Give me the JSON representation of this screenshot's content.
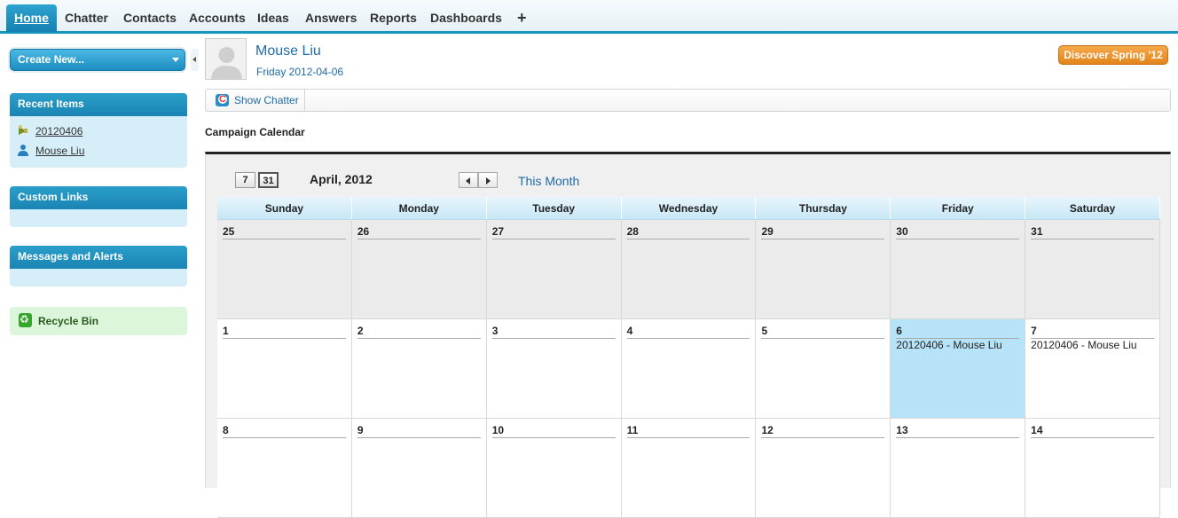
{
  "tabs": [
    {
      "label": "Home",
      "active": true
    },
    {
      "label": "Chatter"
    },
    {
      "label": "Contacts"
    },
    {
      "label": "Accounts"
    },
    {
      "label": "Ideas"
    },
    {
      "label": "Answers"
    },
    {
      "label": "Reports"
    },
    {
      "label": "Dashboards"
    },
    {
      "label": "+",
      "icon": "plus-icon"
    }
  ],
  "sidebar": {
    "create_new": "Create New...",
    "recent_items": {
      "title": "Recent Items",
      "items": [
        {
          "label": "20120406",
          "icon": "campaign-icon"
        },
        {
          "label": "Mouse Liu",
          "icon": "user-icon"
        }
      ]
    },
    "custom_links": {
      "title": "Custom Links"
    },
    "messages": {
      "title": "Messages and Alerts"
    },
    "recycle_bin": {
      "label": "Recycle Bin",
      "icon": "recycle-bin-icon"
    }
  },
  "header": {
    "user_name": "Mouse Liu",
    "date": "Friday 2012-04-06",
    "discover": "Discover Spring '12"
  },
  "chatter": {
    "show_label": "Show Chatter",
    "icon": "chatter-icon"
  },
  "calendar": {
    "section_title": "Campaign Calendar",
    "view_day": "7",
    "view_month": "31",
    "month_title": "April, 2012",
    "this_month": "This Month",
    "weekdays": [
      "Sunday",
      "Monday",
      "Tuesday",
      "Wednesday",
      "Thursday",
      "Friday",
      "Saturday"
    ],
    "weeks": [
      [
        {
          "day": "25",
          "other": true
        },
        {
          "day": "26",
          "other": true
        },
        {
          "day": "27",
          "other": true
        },
        {
          "day": "28",
          "other": true
        },
        {
          "day": "29",
          "other": true
        },
        {
          "day": "30",
          "other": true
        },
        {
          "day": "31",
          "other": true
        }
      ],
      [
        {
          "day": "1"
        },
        {
          "day": "2"
        },
        {
          "day": "3"
        },
        {
          "day": "4"
        },
        {
          "day": "5"
        },
        {
          "day": "6",
          "today": true,
          "event": "20120406 - Mouse Liu"
        },
        {
          "day": "7",
          "event": "20120406 - Mouse Liu"
        }
      ],
      [
        {
          "day": "8"
        },
        {
          "day": "9"
        },
        {
          "day": "10"
        },
        {
          "day": "11"
        },
        {
          "day": "12"
        },
        {
          "day": "13"
        },
        {
          "day": "14"
        }
      ]
    ]
  },
  "colors": {
    "accent": "#1797c0",
    "today": "#b7e3f8",
    "orange": "#e2851c"
  }
}
